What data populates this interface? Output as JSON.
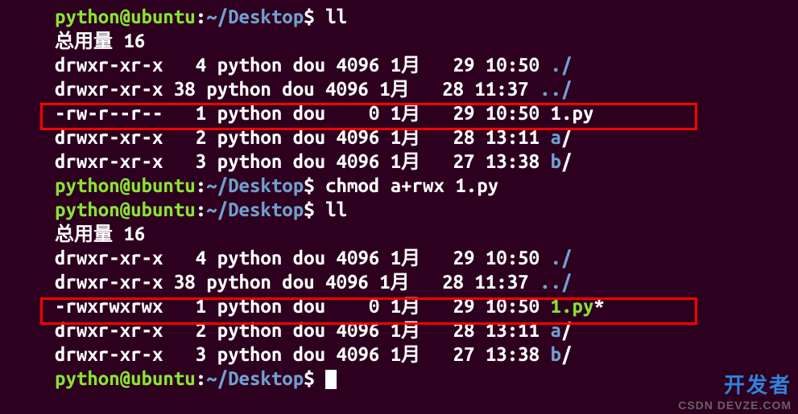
{
  "prompt": {
    "user_host": "python@ubuntu",
    "colon": ":",
    "path": "~/Desktop",
    "dollar": "$"
  },
  "cmds": {
    "ll1": "ll",
    "chmod": "chmod a+rwx 1.py",
    "ll2": "ll",
    "empty": ""
  },
  "totals": {
    "line1": "总用量 16",
    "line2": "总用量 16"
  },
  "ls1": [
    {
      "perm": "drwxr-xr-x",
      "links": " 4",
      "owner": "python",
      "group": "dou",
      "size": "4096",
      "month": "1月",
      "day": " 29",
      "time": "10:50",
      "name": "./",
      "cls": "dir"
    },
    {
      "perm": "drwxr-xr-x",
      "links": "38",
      "owner": "python",
      "group": "dou",
      "size": "4096",
      "month": "1月",
      "day": " 28",
      "time": "11:37",
      "name": "../",
      "cls": "dir"
    },
    {
      "perm": "-rw-r--r--",
      "links": " 1",
      "owner": "python",
      "group": "dou",
      "size": "   0",
      "month": "1月",
      "day": " 29",
      "time": "10:50",
      "name": "1.py",
      "cls": "plain"
    },
    {
      "perm": "drwxr-xr-x",
      "links": " 2",
      "owner": "python",
      "group": "dou",
      "size": "4096",
      "month": "1月",
      "day": " 28",
      "time": "13:11",
      "name": "a",
      "suffix": "/",
      "cls": "dir"
    },
    {
      "perm": "drwxr-xr-x",
      "links": " 3",
      "owner": "python",
      "group": "dou",
      "size": "4096",
      "month": "1月",
      "day": " 27",
      "time": "13:38",
      "name": "b",
      "suffix": "/",
      "cls": "dir"
    }
  ],
  "ls2": [
    {
      "perm": "drwxr-xr-x",
      "links": " 4",
      "owner": "python",
      "group": "dou",
      "size": "4096",
      "month": "1月",
      "day": " 29",
      "time": "10:50",
      "name": "./",
      "cls": "dir"
    },
    {
      "perm": "drwxr-xr-x",
      "links": "38",
      "owner": "python",
      "group": "dou",
      "size": "4096",
      "month": "1月",
      "day": " 28",
      "time": "11:37",
      "name": "../",
      "cls": "dir"
    },
    {
      "perm": "-rwxrwxrwx",
      "links": " 1",
      "owner": "python",
      "group": "dou",
      "size": "   0",
      "month": "1月",
      "day": " 29",
      "time": "10:50",
      "name": "1.py",
      "suffix": "*",
      "cls": "exec"
    },
    {
      "perm": "drwxr-xr-x",
      "links": " 2",
      "owner": "python",
      "group": "dou",
      "size": "4096",
      "month": "1月",
      "day": " 28",
      "time": "13:11",
      "name": "a",
      "suffix": "/",
      "cls": "dir"
    },
    {
      "perm": "drwxr-xr-x",
      "links": " 3",
      "owner": "python",
      "group": "dou",
      "size": "4096",
      "month": "1月",
      "day": " 27",
      "time": "13:38",
      "name": "b",
      "suffix": "/",
      "cls": "dir"
    }
  ],
  "watermark": {
    "line1": "开发者",
    "line2": "CSDN DEVZE.COM"
  },
  "chart_data": null
}
